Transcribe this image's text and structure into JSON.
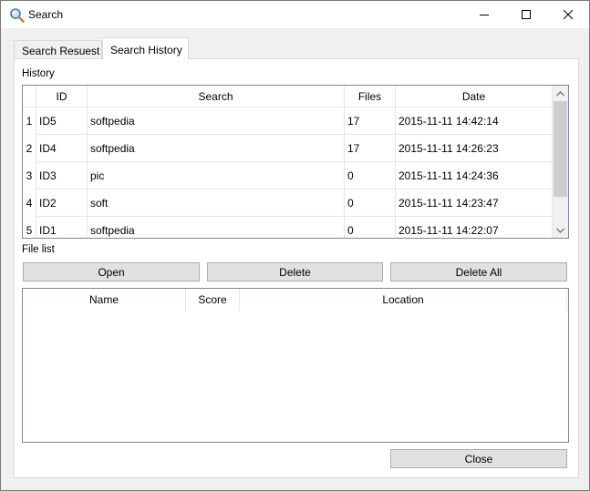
{
  "window": {
    "title": "Search",
    "icon": "magnifier-icon"
  },
  "tabs": [
    {
      "label": "Search Resuest",
      "active": false
    },
    {
      "label": "Search History",
      "active": true
    }
  ],
  "history": {
    "label": "History",
    "columns": [
      "ID",
      "Search",
      "Files",
      "Date"
    ],
    "rows": [
      {
        "num": "1",
        "id": "ID5",
        "search": "softpedia",
        "files": "17",
        "date": "2015-11-11 14:42:14"
      },
      {
        "num": "2",
        "id": "ID4",
        "search": "softpedia",
        "files": "17",
        "date": "2015-11-11 14:26:23"
      },
      {
        "num": "3",
        "id": "ID3",
        "search": "pic",
        "files": "0",
        "date": "2015-11-11 14:24:36"
      },
      {
        "num": "4",
        "id": "ID2",
        "search": "soft",
        "files": "0",
        "date": "2015-11-11 14:23:47"
      },
      {
        "num": "5",
        "id": "ID1",
        "search": "softpedia",
        "files": "0",
        "date": "2015-11-11 14:22:07"
      }
    ]
  },
  "file_list": {
    "label": "File list",
    "columns": [
      "Name",
      "Score",
      "Location"
    ]
  },
  "buttons": {
    "open": "Open",
    "delete": "Delete",
    "delete_all": "Delete All",
    "close": "Close"
  }
}
